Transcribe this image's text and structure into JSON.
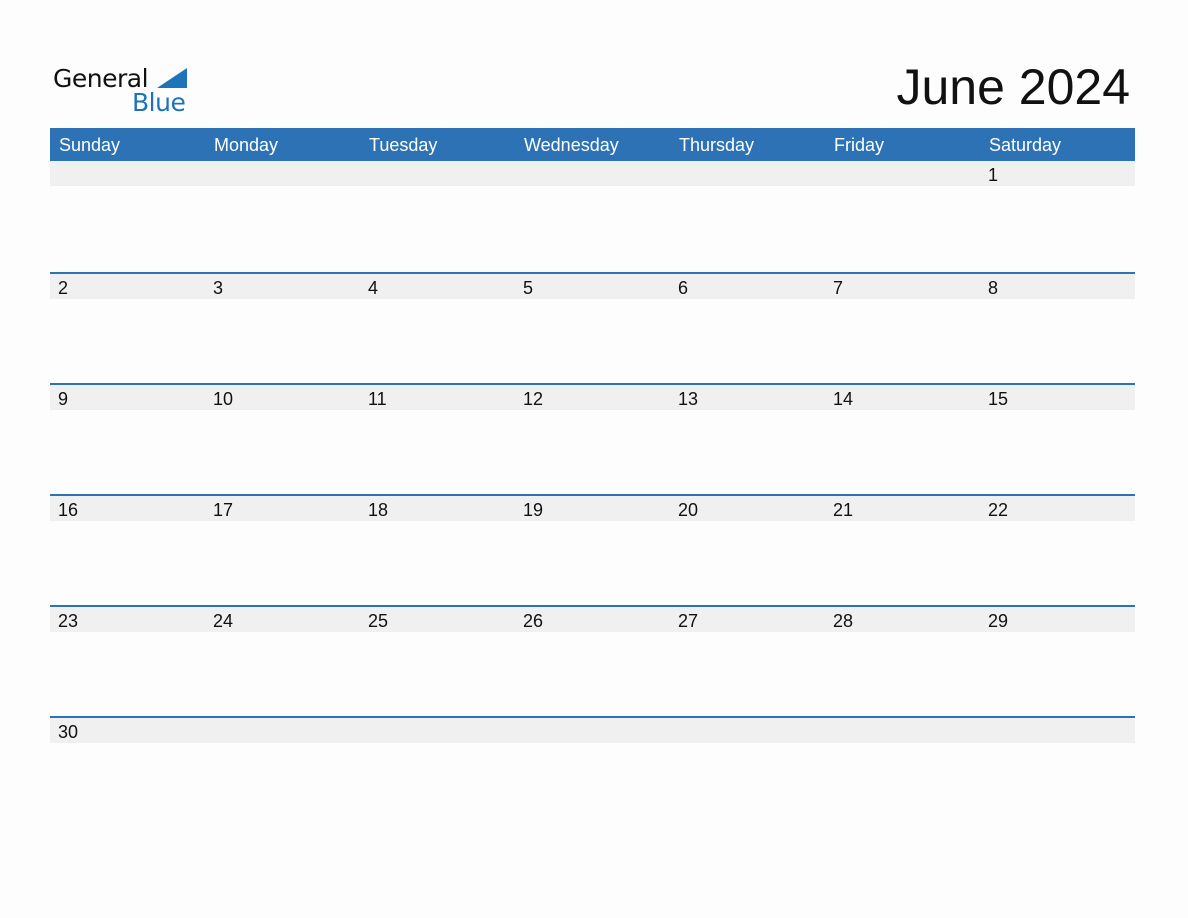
{
  "brand": {
    "line1": "General",
    "line2": "Blue",
    "accent": "#1f73b8"
  },
  "title": "June 2024",
  "colors": {
    "header": "#2d72b5",
    "band": "#f0f0f0"
  },
  "weekdays": [
    "Sunday",
    "Monday",
    "Tuesday",
    "Wednesday",
    "Thursday",
    "Friday",
    "Saturday"
  ],
  "weeks": [
    [
      "",
      "",
      "",
      "",
      "",
      "",
      "1"
    ],
    [
      "2",
      "3",
      "4",
      "5",
      "6",
      "7",
      "8"
    ],
    [
      "9",
      "10",
      "11",
      "12",
      "13",
      "14",
      "15"
    ],
    [
      "16",
      "17",
      "18",
      "19",
      "20",
      "21",
      "22"
    ],
    [
      "23",
      "24",
      "25",
      "26",
      "27",
      "28",
      "29"
    ],
    [
      "30",
      "",
      "",
      "",
      "",
      "",
      ""
    ]
  ]
}
